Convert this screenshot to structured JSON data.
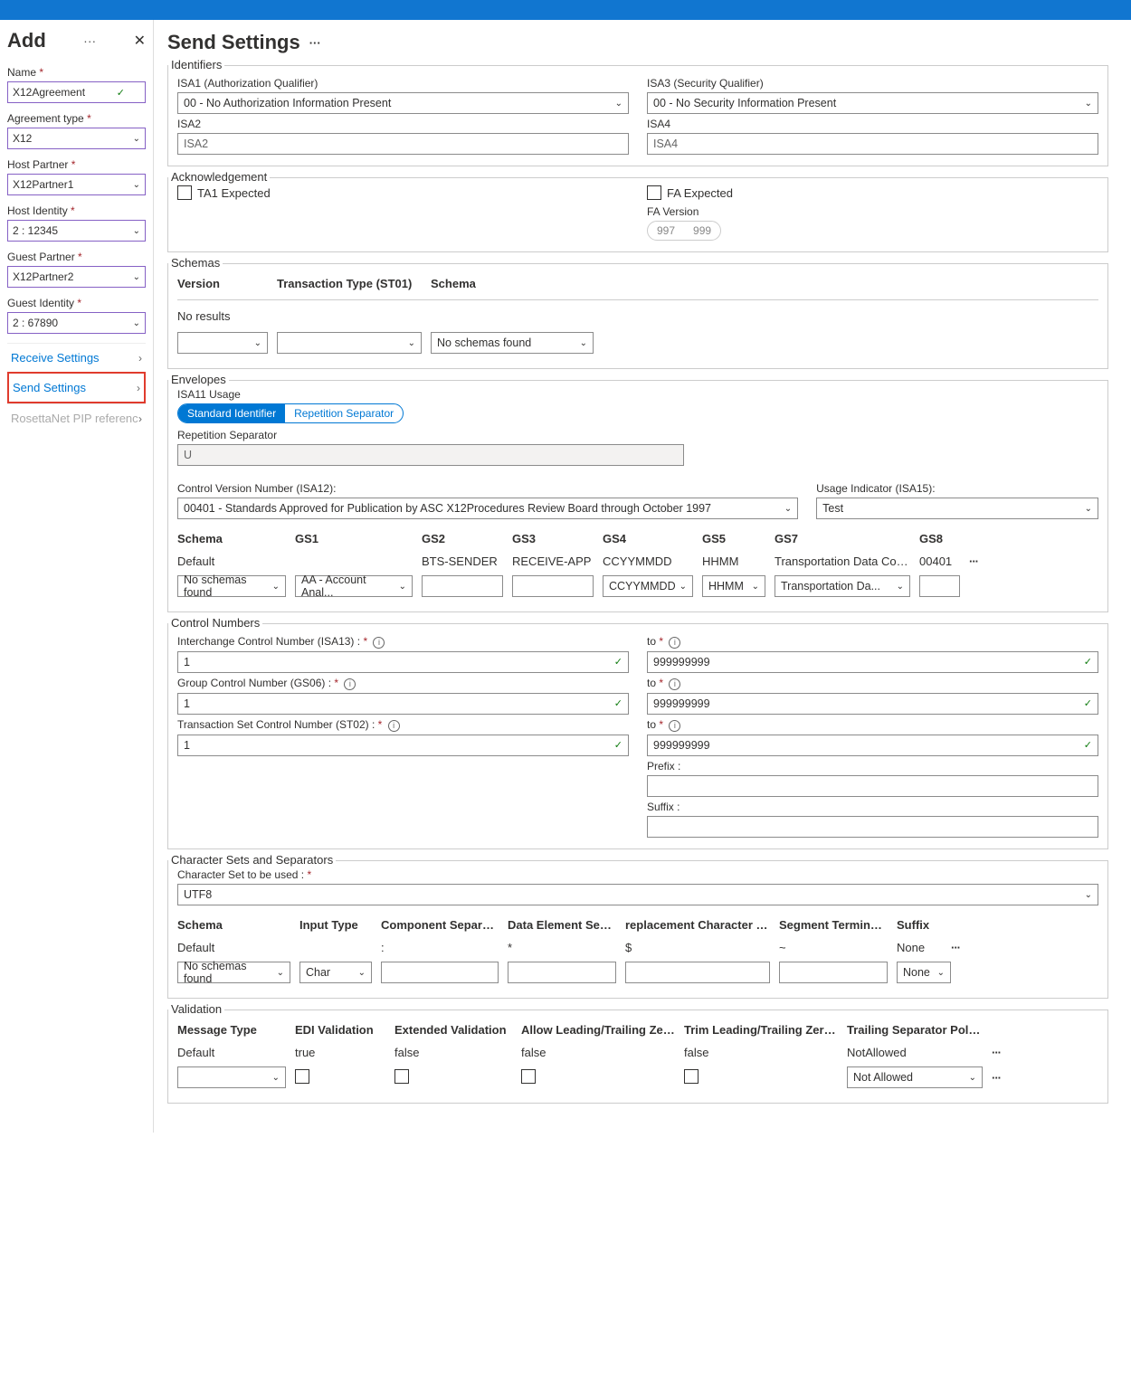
{
  "sidebar": {
    "title": "Add",
    "fields": {
      "name_label": "Name",
      "name_value": "X12Agreement",
      "agreement_type_label": "Agreement type",
      "agreement_type_value": "X12",
      "host_partner_label": "Host Partner",
      "host_partner_value": "X12Partner1",
      "host_identity_label": "Host Identity",
      "host_identity_value": "2 : 12345",
      "guest_partner_label": "Guest Partner",
      "guest_partner_value": "X12Partner2",
      "guest_identity_label": "Guest Identity",
      "guest_identity_value": "2 : 67890"
    },
    "nav": {
      "receive": "Receive Settings",
      "send": "Send Settings",
      "rosetta": "RosettaNet PIP referenc"
    }
  },
  "main": {
    "title": "Send Settings",
    "identifiers": {
      "title": "Identifiers",
      "isa1_label": "ISA1 (Authorization Qualifier)",
      "isa1_value": "00 - No Authorization Information Present",
      "isa3_label": "ISA3 (Security Qualifier)",
      "isa3_value": "00 - No Security Information Present",
      "isa2_label": "ISA2",
      "isa2_placeholder": "ISA2",
      "isa4_label": "ISA4",
      "isa4_placeholder": "ISA4"
    },
    "ack": {
      "title": "Acknowledgement",
      "ta1": "TA1 Expected",
      "fa": "FA Expected",
      "fa_version_label": "FA Version",
      "opt997": "997",
      "opt999": "999"
    },
    "schemas": {
      "title": "Schemas",
      "col_version": "Version",
      "col_tt": "Transaction Type (ST01)",
      "col_schema": "Schema",
      "no_results": "No results",
      "no_schemas": "No schemas found"
    },
    "envelopes": {
      "title": "Envelopes",
      "isa11_label": "ISA11 Usage",
      "std_id": "Standard Identifier",
      "rep_sep": "Repetition Separator",
      "rep_sep_label": "Repetition Separator",
      "rep_sep_value": "U",
      "cvn_label": "Control Version Number (ISA12):",
      "cvn_value": "00401 - Standards Approved for Publication by ASC X12Procedures Review Board through October 1997",
      "usage_label": "Usage Indicator (ISA15):",
      "usage_value": "Test",
      "cols": [
        "Schema",
        "GS1",
        "GS2",
        "GS3",
        "GS4",
        "GS5",
        "GS7",
        "GS8"
      ],
      "default_row": [
        "Default",
        "",
        "BTS-SENDER",
        "RECEIVE-APP",
        "CCYYMMDD",
        "HHMM",
        "Transportation Data Coo...",
        "00401"
      ],
      "input_row": [
        "No schemas found",
        "AA - Account Anal...",
        "",
        "",
        "CCYYMMDD",
        "HHMM",
        "Transportation Da...",
        ""
      ]
    },
    "control": {
      "title": "Control Numbers",
      "icn_label": "Interchange Control Number (ISA13) :",
      "gcn_label": "Group Control Number (GS06) :",
      "tscn_label": "Transaction Set Control Number (ST02) :",
      "to_label": "to",
      "from_val": "1",
      "to_val": "999999999",
      "prefix_label": "Prefix :",
      "suffix_label": "Suffix :"
    },
    "charset": {
      "title": "Character Sets and Separators",
      "cs_label": "Character Set to be used :",
      "cs_value": "UTF8",
      "cols": [
        "Schema",
        "Input Type",
        "Component Separator",
        "Data Element Sep...",
        "replacement Character Sep...",
        "Segment Terminator",
        "Suffix"
      ],
      "default_row": [
        "Default",
        "",
        ":",
        "*",
        "$",
        "~",
        "None"
      ],
      "no_schemas": "No schemas found",
      "char": "Char",
      "none": "None"
    },
    "validation": {
      "title": "Validation",
      "cols": [
        "Message Type",
        "EDI Validation",
        "Extended Validation",
        "Allow Leading/Trailing Zeros",
        "Trim Leading/Trailing Zeroes",
        "Trailing Separator Policy"
      ],
      "default_row": [
        "Default",
        "true",
        "false",
        "false",
        "false",
        "NotAllowed"
      ],
      "not_allowed": "Not Allowed"
    }
  }
}
